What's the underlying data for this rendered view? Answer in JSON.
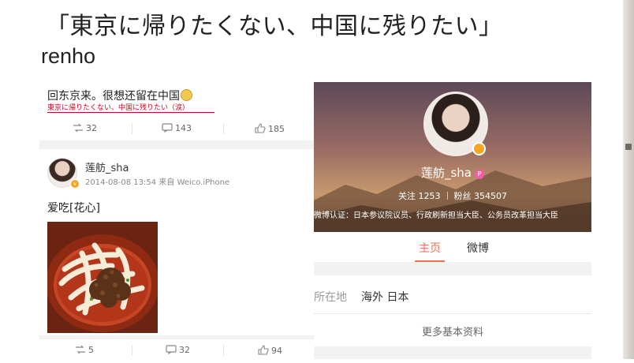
{
  "header": {
    "title": "「東京に帰りたくない、中国に残りたい」",
    "author": "renho"
  },
  "left_panel": {
    "post1": {
      "text": "回东京来。很想还留在中国",
      "emoji": "crying-face",
      "annotation": "東京に帰りたくない、中国に残りたい（涙）",
      "repost_count": "32",
      "comment_count": "143",
      "like_count": "185"
    },
    "post2": {
      "username": "莲舫_sha",
      "meta": "2014-08-08 13:54 来自 Weico.iPhone",
      "text": "爱吃[花心]",
      "image": "noodle-dish",
      "repost_count": "5",
      "comment_count": "32",
      "like_count": "94"
    }
  },
  "right_panel": {
    "profile_name": "莲舫_sha",
    "profile_badge": "P",
    "following_label": "关注 1253",
    "followers_label": "粉丝 354507",
    "verification": "微博认证：日本参议院议员、行政刷新担当大臣、公务员改革担当大臣",
    "tabs": [
      "主页",
      "微博"
    ],
    "location_label": "所在地",
    "location_value": "海外 日本",
    "more_info": "更多基本资料"
  },
  "colors": {
    "accent": "#eb7350",
    "annotation_red": "#d0021b",
    "verified_badge": "#f5a623"
  }
}
